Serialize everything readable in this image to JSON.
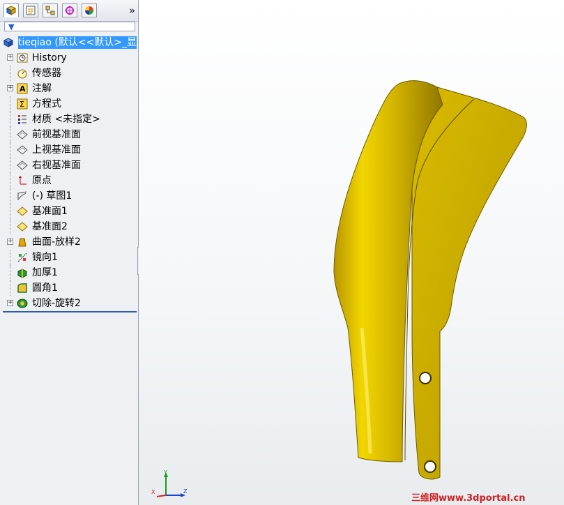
{
  "feature_manager": {
    "tabs": [
      {
        "icon": "feature-manager-icon"
      },
      {
        "icon": "property-manager-icon"
      },
      {
        "icon": "configuration-manager-icon"
      },
      {
        "icon": "dimxpert-icon"
      },
      {
        "icon": "display-manager-icon"
      }
    ],
    "more_label": "»",
    "filter_icon": "filter-icon",
    "root_label": "tieqiao  (默认<<默认>_显",
    "items": [
      {
        "label": "History",
        "icon": "history-icon",
        "expandable": true
      },
      {
        "label": "传感器",
        "icon": "sensor-icon",
        "expandable": false
      },
      {
        "label": "注解",
        "icon": "annotation-icon",
        "expandable": true
      },
      {
        "label": "方程式",
        "icon": "equation-icon",
        "expandable": false
      },
      {
        "label": "材质 <未指定>",
        "icon": "material-icon",
        "expandable": false
      },
      {
        "label": "前视基准面",
        "icon": "plane-icon",
        "expandable": false
      },
      {
        "label": "上视基准面",
        "icon": "plane-icon",
        "expandable": false
      },
      {
        "label": "右视基准面",
        "icon": "plane-icon",
        "expandable": false
      },
      {
        "label": "原点",
        "icon": "origin-icon",
        "expandable": false
      },
      {
        "label": "(-) 草图1",
        "icon": "sketch-icon",
        "expandable": false
      },
      {
        "label": "基准面1",
        "icon": "ref-plane-icon",
        "expandable": false
      },
      {
        "label": "基准面2",
        "icon": "ref-plane-icon",
        "expandable": false
      },
      {
        "label": "曲面-放样2",
        "icon": "surface-loft-icon",
        "expandable": true
      },
      {
        "label": "镜向1",
        "icon": "mirror-icon",
        "expandable": false
      },
      {
        "label": "加厚1",
        "icon": "thicken-icon",
        "expandable": false
      },
      {
        "label": "圆角1",
        "icon": "fillet-icon",
        "expandable": false
      },
      {
        "label": "切除-旋转2",
        "icon": "cut-revolve-icon",
        "expandable": true
      }
    ]
  },
  "triad": {
    "x": "X",
    "y": "Y",
    "z": "Z"
  },
  "watermark": "三维网www.3dportal.cn",
  "colors": {
    "part": "#c9a800",
    "selection": "#3399ff",
    "axis_x": "#d22",
    "axis_y": "#1a9a1a",
    "axis_z": "#2244cc"
  }
}
